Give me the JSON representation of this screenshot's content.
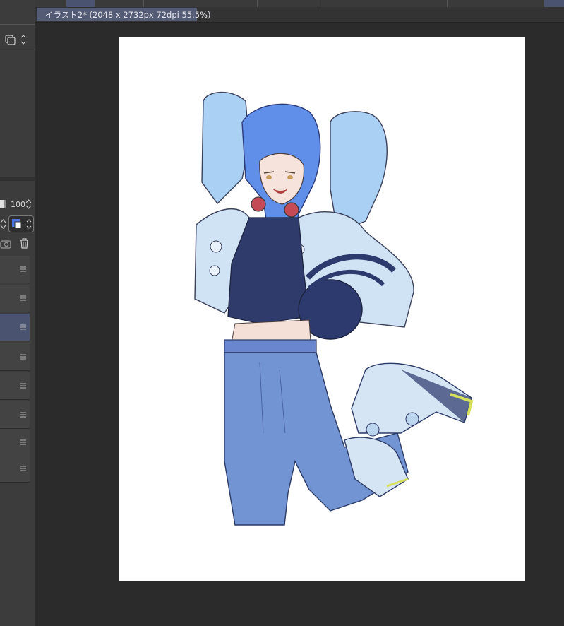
{
  "document_tab": {
    "label": "イラスト2* (2048 x 2732px 72dpi 55.5%)"
  },
  "layer_properties": {
    "opacity_value": "100"
  },
  "layers": [
    {
      "selected": false
    },
    {
      "selected": false
    },
    {
      "selected": true
    },
    {
      "selected": false
    },
    {
      "selected": false
    },
    {
      "selected": false
    },
    {
      "selected": false
    },
    {
      "selected": false
    }
  ],
  "colors": {
    "background": "#2b2b2b",
    "panel": "#3c3c3c",
    "tab_active": "#545b74",
    "layer_selected": "#4a5370",
    "canvas": "#ffffff"
  },
  "icons": {
    "layer_color": "layer-color-icon",
    "new_layer": "new-layer-icon",
    "delete": "trash-icon",
    "layer_menu": "hamburger-menu-icon"
  }
}
